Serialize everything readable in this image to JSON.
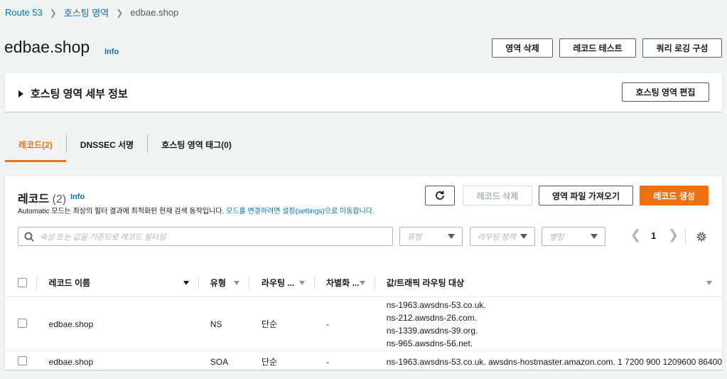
{
  "breadcrumb": {
    "items": [
      "Route 53",
      "호스팅 영역",
      "edbae.shop"
    ]
  },
  "header": {
    "title": "edbae.shop",
    "info": "Info",
    "buttons": {
      "delete_zone": "영역 삭제",
      "test_record": "레코드 테스트",
      "query_logging": "쿼리 로깅 구성"
    }
  },
  "details": {
    "title": "호스팅 영역 세부 정보",
    "edit_button": "호스팅 영역 편집"
  },
  "tabs": [
    {
      "label": "레코드(2)",
      "active": true
    },
    {
      "label": "DNSSEC 서명",
      "active": false
    },
    {
      "label": "호스팅 영역 태그(0)",
      "active": false
    }
  ],
  "records": {
    "title": "레코드",
    "count": "(2)",
    "info": "Info",
    "description": "Automatic 모드는 최상의 필터 결과에 최적화된 현재 검색 동작입니다.",
    "description_link": "모드를 변경하려면 설정(settings)으로 이동합니다.",
    "buttons": {
      "delete": "레코드 삭제",
      "import": "영역 파일 가져오기",
      "create": "레코드 생성"
    },
    "search_placeholder": "속성 또는 값을 기준으로 레코드 필터링",
    "filters": {
      "type": "유형",
      "routing": "라우팅 정책",
      "alias": "별칭"
    },
    "page": "1",
    "columns": [
      "레코드 이름",
      "유형",
      "라우팅 ...",
      "차별화 ...",
      "값/트래픽 라우팅 대상"
    ],
    "rows": [
      {
        "name": "edbae.shop",
        "type": "NS",
        "routing": "단순",
        "diff": "-",
        "values": [
          "ns-1963.awsdns-53.co.uk.",
          "ns-212.awsdns-26.com.",
          "ns-1339.awsdns-39.org.",
          "ns-965.awsdns-56.net."
        ]
      },
      {
        "name": "edbae.shop",
        "type": "SOA",
        "routing": "단순",
        "diff": "-",
        "values": [
          "ns-1963.awsdns-53.co.uk. awsdns-hostmaster.amazon.com. 1 7200 900 1209600 86400"
        ]
      }
    ]
  },
  "colors": {
    "accent": "#ec7211",
    "link": "#0073bb"
  }
}
